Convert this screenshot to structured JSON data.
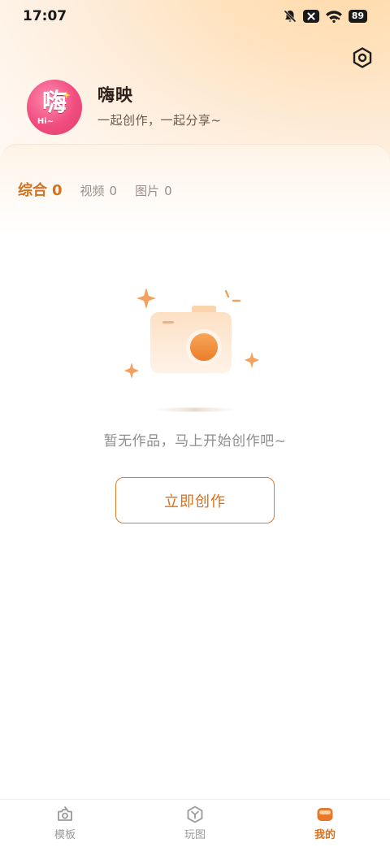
{
  "status_bar": {
    "time": "17:07",
    "battery": "89",
    "icons": [
      "bell-muted-icon",
      "close-badge-icon",
      "wifi-icon",
      "battery-icon"
    ]
  },
  "header": {
    "settings_icon": "gear-icon"
  },
  "profile": {
    "avatar_text": "嗨",
    "avatar_subtext": "Hi~",
    "name": "嗨映",
    "slogan": "一起创作，一起分享~"
  },
  "tabs": [
    {
      "label": "综合",
      "count": "0",
      "active": true
    },
    {
      "label": "视频",
      "count": "0",
      "active": false
    },
    {
      "label": "图片",
      "count": "0",
      "active": false
    }
  ],
  "empty_state": {
    "illustration": "camera-icon",
    "message": "暂无作品，马上开始创作吧~",
    "button_label": "立即创作"
  },
  "bottom_nav": [
    {
      "label": "模板",
      "icon": "template-icon",
      "active": false
    },
    {
      "label": "玩图",
      "icon": "play-image-icon",
      "active": false
    },
    {
      "label": "我的",
      "icon": "profile-icon",
      "active": true
    }
  ],
  "colors": {
    "accent": "#d9701d",
    "header_gradient": "#ffd9a8",
    "avatar_pink": "#f04d7f"
  }
}
